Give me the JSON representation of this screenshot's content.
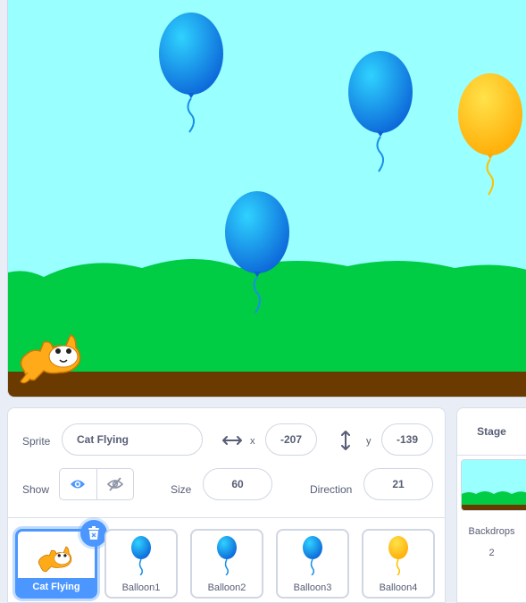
{
  "sprite_info": {
    "sprite_label": "Sprite",
    "sprite_name": "Cat Flying",
    "x_label": "x",
    "x_value": "-207",
    "y_label": "y",
    "y_value": "-139",
    "show_label": "Show",
    "size_label": "Size",
    "size_value": "60",
    "direction_label": "Direction",
    "direction_value": "21"
  },
  "sprites": [
    {
      "name": "Cat Flying",
      "selected": true
    },
    {
      "name": "Balloon1"
    },
    {
      "name": "Balloon2"
    },
    {
      "name": "Balloon3"
    },
    {
      "name": "Balloon4"
    }
  ],
  "stage_pane": {
    "title": "Stage",
    "backdrops_label": "Backdrops",
    "backdrops_count": "2"
  },
  "colors": {
    "sky": "#99ffff",
    "hills": "#00cc44",
    "ground": "#6b3a00",
    "accent": "#4c97ff",
    "balloon_blue": "#1a8fe8",
    "balloon_yellow": "#ffc000"
  }
}
